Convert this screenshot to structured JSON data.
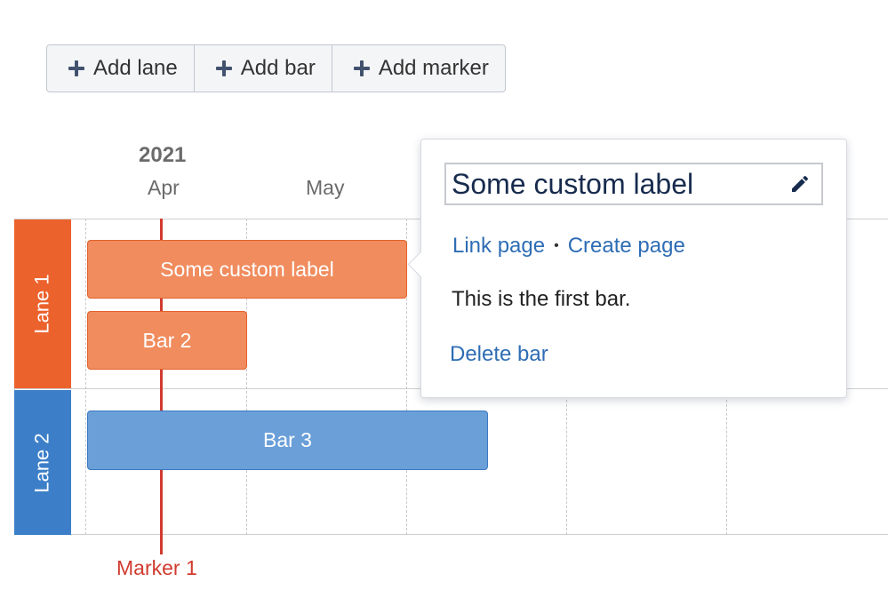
{
  "toolbar": {
    "add_lane": "Add lane",
    "add_bar": "Add bar",
    "add_marker": "Add marker"
  },
  "timeline": {
    "year": "2021",
    "months": [
      "Apr",
      "May"
    ]
  },
  "lanes": [
    {
      "label": "Lane 1",
      "color": "#ec622c"
    },
    {
      "label": "Lane 2",
      "color": "#3c7fc8"
    }
  ],
  "bars": {
    "bar1": "Some custom label",
    "bar2": "Bar 2",
    "bar3": "Bar 3"
  },
  "marker": {
    "label": "Marker 1",
    "color": "#d13a2f"
  },
  "popup": {
    "title": "Some custom label",
    "link_page": "Link page",
    "create_page": "Create page",
    "separator": "•",
    "description": "This is the first bar.",
    "delete": "Delete bar"
  },
  "colors": {
    "link": "#2e6db4",
    "bar_orange": "#f08c5e",
    "bar_blue": "#6a9fd8"
  }
}
